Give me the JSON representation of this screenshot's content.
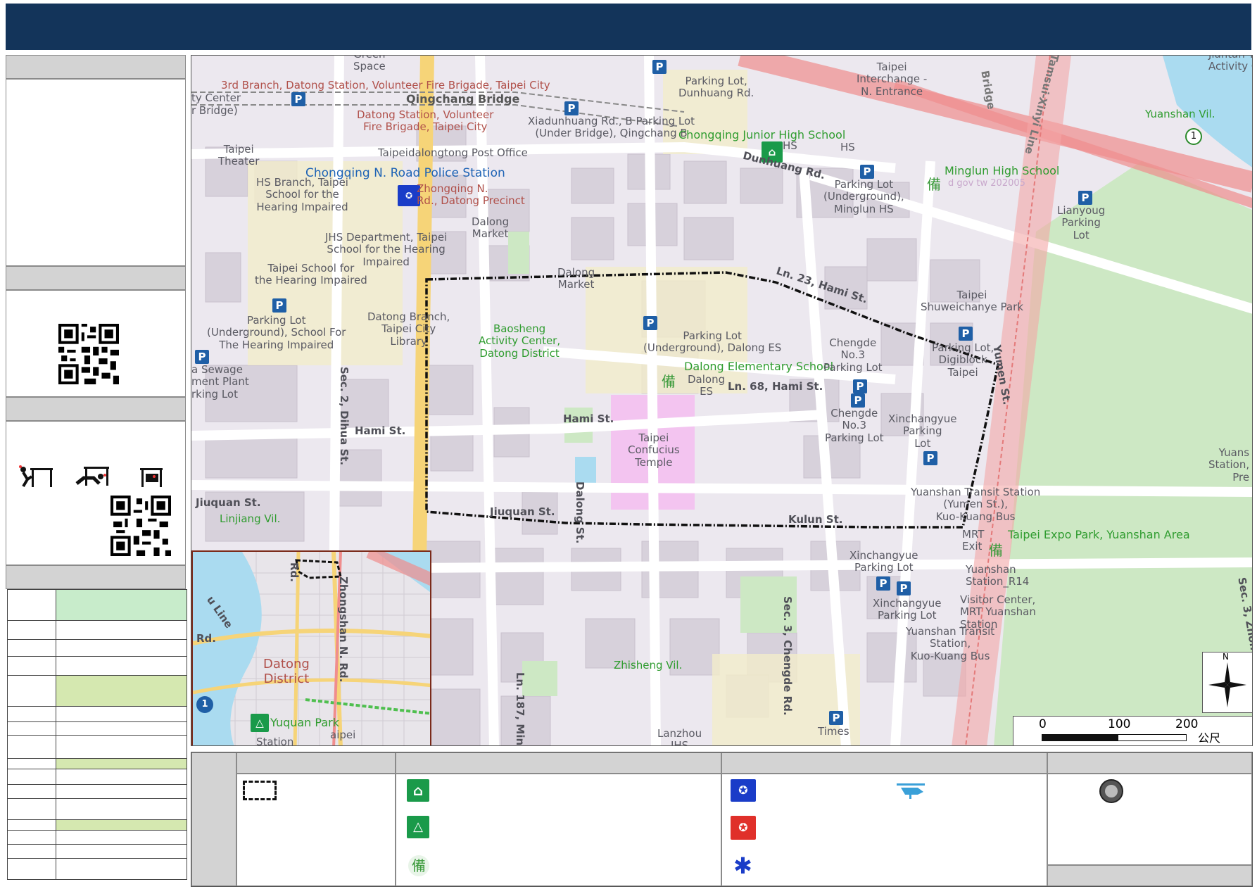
{
  "map_labels": {
    "green_space": "Green\nSpace",
    "fire_brigade_3rd": "3rd Branch, Datong Station, Volunteer Fire Brigade, Taipei City",
    "qingchang_bridge": "Qingchang Bridge",
    "ty_center": "ty Center",
    "r_bridge": "r Bridge)",
    "datong_station_fire": "Datong Station, Volunteer\nFire Brigade, Taipei City",
    "post_office": "Taipeidalongtong Post Office",
    "police_station": "Chongqing N. Road Police Station",
    "zhongqing_precinct": "Zhongqing N.\nRd., Datong Precinct",
    "taipei_theater": "Taipei\nTheater",
    "hs_branch": "HS Branch, Taipei\nSchool for the\nHearing Impaired",
    "dalong_market_1": "Dalong\nMarket",
    "jhs_department": "JHS Department, Taipei\nSchool for the Hearing\nImpaired",
    "taipei_school_hearing": "Taipei School for\nthe Hearing Impaired",
    "parking_school_hearing": "Parking Lot\n(Underground), School For\nThe Hearing Impaired",
    "sewage_plant": "a Sewage\nment Plant\nrking Lot",
    "datong_branch_library": "Datong Branch,\nTaipei City\nLibrary",
    "dalong_market_2": "Dalong\nMarket",
    "baosheng": "Baosheng\nActivity Center,\nDatong District",
    "parking_dunhuang": "Parking Lot,\nDunhuang Rd.",
    "xiadunhuang": "Xiadunhuang Rd., B Parking Lot\n(Under Bridge), Qingchang B",
    "chongqing_jhs": "Chongqing Junior High School",
    "hs_1": "HS",
    "hs_2": "HS",
    "dunhuang_rd": "Dunhuang Rd.",
    "taipei_interchange": "Taipei\nInterchange -\nN. Entrance",
    "parking_minglun": "Parking Lot\n(Underground),\nMinglun HS",
    "minglun_hs": "Minglun High School",
    "faded_text": "d gov tw 202005",
    "yuanshan_vil": "Yuanshan Vil.",
    "lianyoung": "Lianyoug\nParking\nLot",
    "jiantan": "Jiantan Yo\nActivity Ce",
    "ln23": "Ln. 23, Hami St.",
    "shuweichanye": "Taipei\nShuweichanye Park",
    "parking_dalong_es": "Parking Lot\n(Underground), Dalong ES",
    "dalong_es": "Dalong Elementary School",
    "dalong_es_short": "Dalong\nES",
    "ln68": "Ln. 68, Hami St.",
    "chengde_no3_a": "Chengde\nNo.3\nParking Lot",
    "chengde_no3_b": "Chengde\nNo.3\nParking Lot",
    "parking_digiblock": "Parking Lot,\nDigiblock\nTaipei",
    "xinchangyue_1": "Xinchangyue\nParking\nLot",
    "confucius": "Taipei\nConfucius\nTemple",
    "hami_st_1": "Hami St.",
    "hami_st_2": "Hami St.",
    "dalong_st": "Dalong St.",
    "dihua_st": "Sec. 2, Dihua St.",
    "jiuquan_1": "Jiuquan St.",
    "jiuquan_2": "Jiuquan St.",
    "linjiang": "Linjiang Vil.",
    "kulun": "Kulun St.",
    "yuanshan_transit_1": "Yuanshan Transit Station\n(Yumen St.),\nKuo-Kuang Bus",
    "mrt_exit": "MRT\nExit",
    "expo_park": "Taipei Expo Park, Yuanshan Area",
    "xinchangyue_2": "Xinchangyue\nParking Lot",
    "xinchangyue_3": "Xinchangyue\nParking Lot",
    "yuanshan_r14": "Yuanshan\nStation_R14",
    "visitor_center": "Visitor Center,\nMRT Yuanshan\nStation",
    "yuanshan_transit_2": "Yuanshan Transit\nStation,\nKuo-Kuang Bus",
    "yuanshan_right": "Yuans\nStation,\nPre",
    "zhisheng": "Zhisheng Vil.",
    "ln187": "Ln. 187, Min",
    "chengde_rd": "Sec. 3, Chengde Rd.",
    "times": "Times",
    "lanzhou": "Lanzhou\nJHS",
    "yumen_st": "Yumen St.",
    "zhong_rd": "Sec. 3, Zhong",
    "tamsui_line": "Tamsui-Xinyi Line",
    "bridge": "Bridge"
  },
  "inset": {
    "datong_district": "Datong\nDistrict",
    "yuquan_park": "Yuquan Park",
    "zhongshan_rd": "Zhongshan N. Rd.",
    "line": "u Line",
    "rd": "Rd.",
    "rd2": "Rd.",
    "taipei": "aipei",
    "station": "Station"
  },
  "scale": {
    "t0": "0",
    "t100": "100",
    "t200": "200",
    "unit": "公尺"
  },
  "north": "N",
  "icons": {
    "parking": "P",
    "backup": "備",
    "highway_1": "1",
    "shelter_1": "1"
  },
  "colors": {
    "header": "#13345a",
    "highlight_green": "#c8eccb",
    "highlight_olive": "#d5e8b0",
    "park": "#cde8c4",
    "temple": "#f3c4f0",
    "road_yellow": "#f6d478",
    "rail_red": "#f08d8d"
  }
}
